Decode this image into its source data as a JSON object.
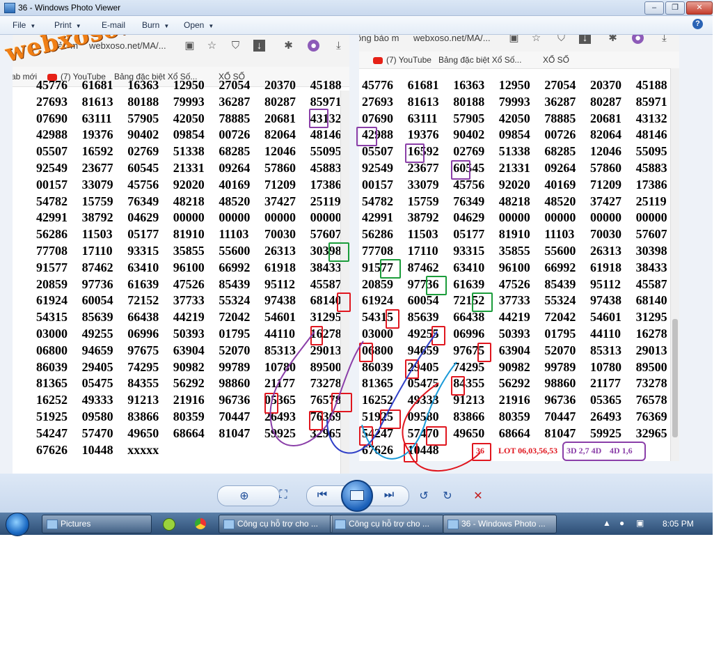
{
  "window": {
    "title": "36 - Windows Photo Viewer",
    "min": "–",
    "max": "❐",
    "close": "✕"
  },
  "menubar": {
    "file": "File",
    "print": "Print",
    "email": "E-mail",
    "burn": "Burn",
    "open": "Open",
    "help": "?"
  },
  "watermark": "webxoso.net",
  "browser_left": {
    "url_prefix": "bảo m",
    "url": "webxoso.net/MA/...",
    "bm_new": "ab mới",
    "bm_youtube": "(7) YouTube",
    "bm_bangdb": "Bảng đặc biệt Xổ Số...",
    "bm_xoso": "XỔ SỐ"
  },
  "browser_right": {
    "url_prefix": "ông bảo m",
    "url": "webxoso.net/MA/...",
    "bm_youtube": "(7) YouTube",
    "bm_bangdb": "Bảng đặc biệt Xổ Số...",
    "bm_xoso": "XỔ SỐ"
  },
  "left_rows": [
    [
      "45776",
      "61681",
      "16363",
      "12950",
      "27054",
      "20370",
      "45188"
    ],
    [
      "27693",
      "81613",
      "80188",
      "79993",
      "36287",
      "80287",
      "85971"
    ],
    [
      "07690",
      "63111",
      "57905",
      "42050",
      "78885",
      "20681",
      "43132"
    ],
    [
      "42988",
      "19376",
      "90402",
      "09854",
      "00726",
      "82064",
      "48146"
    ],
    [
      "05507",
      "16592",
      "02769",
      "51338",
      "68285",
      "12046",
      "55095"
    ],
    [
      "92549",
      "23677",
      "60545",
      "21331",
      "09264",
      "57860",
      "45883"
    ],
    [
      "00157",
      "33079",
      "45756",
      "92020",
      "40169",
      "71209",
      "17386"
    ],
    [
      "54782",
      "15759",
      "76349",
      "48218",
      "48520",
      "37427",
      "25119"
    ],
    [
      "42991",
      "38792",
      "04629",
      "00000",
      "00000",
      "00000",
      "00000"
    ],
    [
      "56286",
      "11503",
      "05177",
      "81910",
      "11103",
      "70030",
      "57607"
    ],
    [
      "77708",
      "17110",
      "93315",
      "35855",
      "55600",
      "26313",
      "30398"
    ],
    [
      "91577",
      "87462",
      "63410",
      "96100",
      "66992",
      "61918",
      "38433"
    ],
    [
      "20859",
      "97736",
      "61639",
      "47526",
      "85439",
      "95112",
      "45587"
    ],
    [
      "61924",
      "60054",
      "72152",
      "37733",
      "55324",
      "97438",
      "68140"
    ],
    [
      "54315",
      "85639",
      "66438",
      "44219",
      "72042",
      "54601",
      "31295"
    ],
    [
      "03000",
      "49255",
      "06996",
      "50393",
      "01795",
      "44110",
      "16278"
    ],
    [
      "06800",
      "94659",
      "97675",
      "63904",
      "52070",
      "85313",
      "29013"
    ],
    [
      "86039",
      "29405",
      "74295",
      "90982",
      "99789",
      "10780",
      "89500"
    ],
    [
      "81365",
      "05475",
      "84355",
      "56292",
      "98860",
      "21177",
      "73278"
    ],
    [
      "16252",
      "49333",
      "91213",
      "21916",
      "96736",
      "05365",
      "76578"
    ],
    [
      "51925",
      "09580",
      "83866",
      "80359",
      "70447",
      "26493",
      "76369"
    ],
    [
      "54247",
      "57470",
      "49650",
      "68664",
      "81047",
      "59925",
      "32965"
    ],
    [
      "67626",
      "10448",
      "xxxxx"
    ]
  ],
  "right_rows": [
    [
      "45776",
      "61681",
      "16363",
      "12950",
      "27054",
      "20370",
      "45188"
    ],
    [
      "27693",
      "81613",
      "80188",
      "79993",
      "36287",
      "80287",
      "85971"
    ],
    [
      "07690",
      "63111",
      "57905",
      "42050",
      "78885",
      "20681",
      "43132"
    ],
    [
      "42988",
      "19376",
      "90402",
      "09854",
      "00726",
      "82064",
      "48146"
    ],
    [
      "05507",
      "16592",
      "02769",
      "51338",
      "68285",
      "12046",
      "55095"
    ],
    [
      "92549",
      "23677",
      "60545",
      "21331",
      "09264",
      "57860",
      "45883"
    ],
    [
      "00157",
      "33079",
      "45756",
      "92020",
      "40169",
      "71209",
      "17386"
    ],
    [
      "54782",
      "15759",
      "76349",
      "48218",
      "48520",
      "37427",
      "25119"
    ],
    [
      "42991",
      "38792",
      "04629",
      "00000",
      "00000",
      "00000",
      "00000"
    ],
    [
      "56286",
      "11503",
      "05177",
      "81910",
      "11103",
      "70030",
      "57607"
    ],
    [
      "77708",
      "17110",
      "93315",
      "35855",
      "55600",
      "26313",
      "30398"
    ],
    [
      "91577",
      "87462",
      "63410",
      "96100",
      "66992",
      "61918",
      "38433"
    ],
    [
      "20859",
      "97736",
      "61639",
      "47526",
      "85439",
      "95112",
      "45587"
    ],
    [
      "61924",
      "60054",
      "72152",
      "37733",
      "55324",
      "97438",
      "68140"
    ],
    [
      "54315",
      "85639",
      "66438",
      "44219",
      "72042",
      "54601",
      "31295"
    ],
    [
      "03000",
      "49255",
      "06996",
      "50393",
      "01795",
      "44110",
      "16278"
    ],
    [
      "06800",
      "94659",
      "97675",
      "63904",
      "52070",
      "85313",
      "29013"
    ],
    [
      "86039",
      "29405",
      "74295",
      "90982",
      "99789",
      "10780",
      "89500"
    ],
    [
      "81365",
      "05475",
      "84355",
      "56292",
      "98860",
      "21177",
      "73278"
    ],
    [
      "16252",
      "49333",
      "91213",
      "21916",
      "96736",
      "05365",
      "76578"
    ],
    [
      "51925",
      "09580",
      "83866",
      "80359",
      "70447",
      "26493",
      "76369"
    ],
    [
      "54247",
      "57470",
      "49650",
      "68664",
      "81047",
      "59925",
      "32965"
    ],
    [
      "67626",
      "10448"
    ]
  ],
  "notes": {
    "badge": "36",
    "lot": "LOT 06,03,56,53",
    "d3": "3D 2,7 4D",
    "d4": "4D 1,6"
  },
  "taskbar": {
    "pictures": "Pictures",
    "tool1": "Công cụ hỗ trợ cho ...",
    "tool2": "Công cụ hỗ trợ cho ...",
    "viewer": "36 - Windows Photo ...",
    "clock": "8:05 PM"
  },
  "colors": {
    "red": "#e0161e",
    "green": "#1a9c3a",
    "purple": "#8a3ea8",
    "blue": "#2f3fc7",
    "cyan": "#1a9ad8",
    "watermark": "#f07f16"
  }
}
